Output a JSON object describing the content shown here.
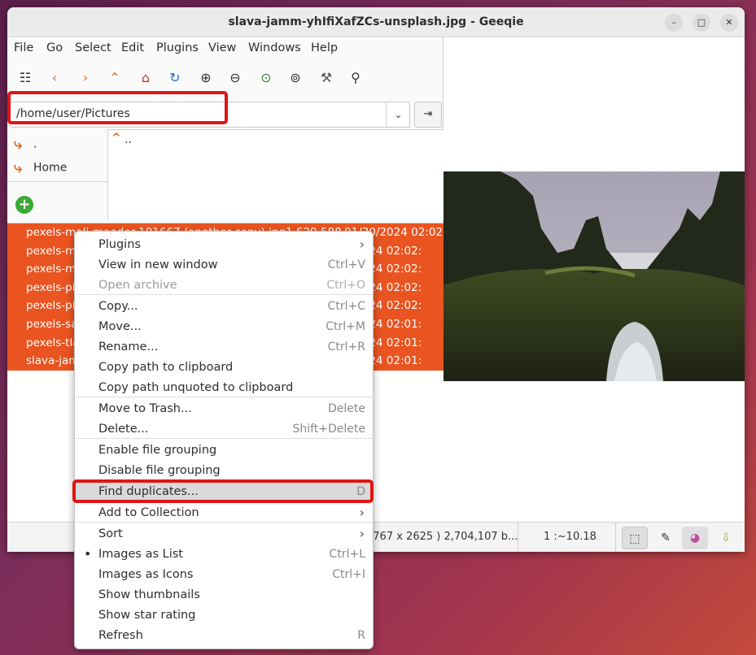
{
  "window": {
    "title": "slava-jamm-yhIfiXafZCs-unsplash.jpg - Geeqie"
  },
  "window_controls": {
    "minimize": "–",
    "maximize": "□",
    "close": "✕"
  },
  "menubar": [
    "File",
    "Go",
    "Select",
    "Edit",
    "Plugins",
    "View",
    "Windows",
    "Help"
  ],
  "toolbar": {
    "icons": [
      {
        "name": "thumbnails-icon",
        "glyph": "☷",
        "color": "#333333"
      },
      {
        "name": "back-icon",
        "glyph": "‹",
        "color": "#e2691f"
      },
      {
        "name": "forward-icon",
        "glyph": "›",
        "color": "#e2691f"
      },
      {
        "name": "up-icon",
        "glyph": "⌃",
        "color": "#e2691f"
      },
      {
        "name": "home-icon",
        "glyph": "⌂",
        "color": "#c0392b"
      },
      {
        "name": "refresh-icon",
        "glyph": "↻",
        "color": "#1f6fd1"
      },
      {
        "name": "zoom-in-icon",
        "glyph": "⊕",
        "color": "#333333"
      },
      {
        "name": "zoom-out-icon",
        "glyph": "⊖",
        "color": "#333333"
      },
      {
        "name": "zoom-fit-icon",
        "glyph": "⊙",
        "color": "#2e8b3c"
      },
      {
        "name": "zoom-original-icon",
        "glyph": "⊚",
        "color": "#333333"
      },
      {
        "name": "preferences-icon",
        "glyph": "⚒",
        "color": "#555555"
      },
      {
        "name": "pin-icon",
        "glyph": "⚲",
        "color": "#333333"
      }
    ]
  },
  "pathbar": {
    "value": "/home/user/Pictures",
    "dropdown": "⌄",
    "go": "⇥"
  },
  "bookmarks": [
    {
      "label": "."
    },
    {
      "label": "Home"
    }
  ],
  "bookmark_add": "+",
  "dirlist": {
    "up_glyph": "^",
    "parent": ".."
  },
  "files": [
    {
      "name": "pexels-mali-maeder-101667 (another copy).jpg",
      "size": "1,629,588",
      "date": "01/30/2024 02:02:"
    },
    {
      "name": "pexels-m",
      "size": "",
      "date": "0/2024 02:02:"
    },
    {
      "name": "pexels-m",
      "size": "",
      "date": "0/2024 02:02:"
    },
    {
      "name": "pexels-pi",
      "size": "",
      "date": "0/2024 02:02:"
    },
    {
      "name": "pexels-pi",
      "size": "",
      "date": "0/2024 02:02:"
    },
    {
      "name": "pexels-sa",
      "size": "",
      "date": "0/2024 02:01:"
    },
    {
      "name": "pexels-tla",
      "size": "",
      "date": "0/2024 02:01:"
    },
    {
      "name": "slava-jam",
      "size": "",
      "date": "0/2024 02:01:"
    }
  ],
  "statusbar": {
    "info": "3767 x 2625 ) 2,704,107 b...",
    "zoom": "1 :~10.18"
  },
  "status_icons": [
    {
      "name": "exif-rotate-icon",
      "glyph": "⬚"
    },
    {
      "name": "color-picker-icon",
      "glyph": "✎"
    },
    {
      "name": "color-profile-icon",
      "glyph": "◕"
    },
    {
      "name": "save-download-icon",
      "glyph": "⇩"
    }
  ],
  "context_menu": {
    "items": [
      {
        "label": "Plugins",
        "accel": "",
        "submenu": true
      },
      {
        "label": "View in new window",
        "accel": "Ctrl+V"
      },
      {
        "label": "Open archive",
        "accel": "Ctrl+O",
        "disabled": true
      },
      {
        "label": "Copy...",
        "accel": "Ctrl+C"
      },
      {
        "label": "Move...",
        "accel": "Ctrl+M"
      },
      {
        "label": "Rename...",
        "accel": "Ctrl+R"
      },
      {
        "label": "Copy path to clipboard",
        "accel": ""
      },
      {
        "label": "Copy path unquoted to clipboard",
        "accel": ""
      },
      {
        "label": "Move to Trash...",
        "accel": "Delete"
      },
      {
        "label": "Delete...",
        "accel": "Shift+Delete"
      },
      {
        "label": "Enable file grouping",
        "accel": ""
      },
      {
        "label": "Disable file grouping",
        "accel": ""
      },
      {
        "label": "Find duplicates...",
        "accel": "D",
        "hover": true
      },
      {
        "label": "Add to Collection",
        "accel": "",
        "submenu": true
      },
      {
        "label": "Sort",
        "accel": "",
        "submenu": true
      },
      {
        "label": "Images as List",
        "accel": "Ctrl+L",
        "checked": true
      },
      {
        "label": "Images as Icons",
        "accel": "Ctrl+I"
      },
      {
        "label": "Show thumbnails",
        "accel": ""
      },
      {
        "label": "Show star rating",
        "accel": ""
      },
      {
        "label": "Refresh",
        "accel": "R"
      }
    ],
    "submenu_glyph": "›",
    "check_glyph": "•"
  },
  "colors": {
    "accent": "#e95420",
    "highlight_box": "#e01515"
  }
}
